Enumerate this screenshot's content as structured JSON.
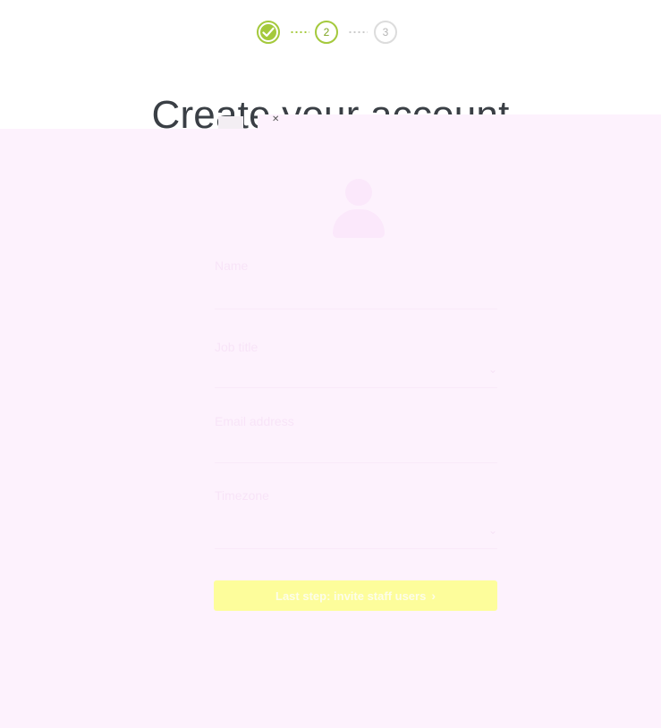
{
  "stepper": {
    "steps": [
      {
        "label": "",
        "state": "done"
      },
      {
        "label": "2",
        "state": "current"
      },
      {
        "label": "3",
        "state": "todo"
      }
    ],
    "done_color": "#a4c93c",
    "todo_color": "#dcdcdc"
  },
  "header": {
    "title": "Create your account"
  },
  "form": {
    "fields": [
      {
        "label": "Name",
        "value": "",
        "has_dropdown": false
      },
      {
        "label": "Job title",
        "value": "",
        "has_dropdown": true
      },
      {
        "label": "Email address",
        "value": "",
        "has_dropdown": false
      },
      {
        "label": "Timezone",
        "value": "",
        "has_dropdown": true
      }
    ]
  },
  "cta": {
    "label": "Last step: invite staff users",
    "icon": "chevron-right-icon",
    "color": "#fdfd9b"
  },
  "overlay": {
    "color": "#fdf2fd"
  }
}
